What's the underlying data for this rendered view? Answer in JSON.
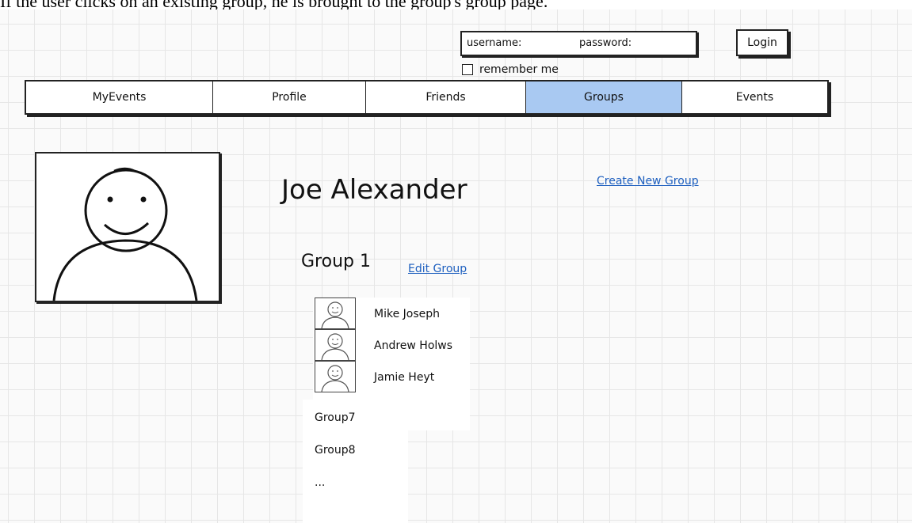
{
  "caption": "If the user clicks on an existing group, he is brought to the group's group page.",
  "login": {
    "username_label": "username:",
    "password_label": "password:",
    "login_button": "Login",
    "remember_label": "remember me"
  },
  "nav": {
    "tabs": [
      {
        "label": "MyEvents",
        "active": false
      },
      {
        "label": "Profile",
        "active": false
      },
      {
        "label": "Friends",
        "active": false
      },
      {
        "label": "Groups",
        "active": true
      },
      {
        "label": "Events",
        "active": false
      }
    ]
  },
  "profile": {
    "name": "Joe Alexander",
    "create_group_link": "Create New Group"
  },
  "group": {
    "title": "Group 1",
    "edit_link": "Edit Group",
    "members": [
      {
        "name": "Mike Joseph"
      },
      {
        "name": "Andrew Holws"
      },
      {
        "name": "Jamie Heyt"
      }
    ]
  },
  "group_list": {
    "items": [
      {
        "label": "Group7"
      },
      {
        "label": "Group8"
      },
      {
        "label": "..."
      }
    ]
  },
  "colors": {
    "active_tab": "#a9c9f2",
    "link": "#1d5fbf",
    "grid": "#e6e6e6"
  }
}
